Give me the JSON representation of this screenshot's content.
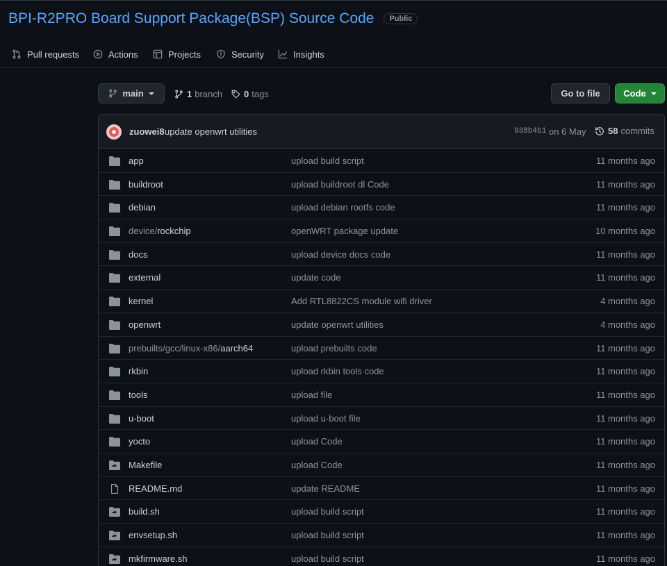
{
  "repo": {
    "title": "BPI-R2PRO Board Support Package(BSP) Source Code",
    "visibility": "Public"
  },
  "nav": [
    {
      "label": "Pull requests",
      "icon": "pull-request-icon"
    },
    {
      "label": "Actions",
      "icon": "play-icon"
    },
    {
      "label": "Projects",
      "icon": "project-board-icon"
    },
    {
      "label": "Security",
      "icon": "shield-icon"
    },
    {
      "label": "Insights",
      "icon": "graph-icon"
    }
  ],
  "toolbar": {
    "branch": "main",
    "branch_count": "1",
    "branch_label": "branch",
    "tag_count": "0",
    "tag_label": "tags",
    "goto_label": "Go to file",
    "code_label": "Code"
  },
  "commit": {
    "author": "zuowei8",
    "message": "update openwrt utilities",
    "hash": "938b4b1",
    "date": "on 6 May",
    "count": "58",
    "count_label": "commits"
  },
  "colors": {
    "link": "#58a6ff",
    "primary_button": "#238636",
    "background": "#0d1117",
    "muted": "#8b949e"
  },
  "files": [
    {
      "type": "dir",
      "prefix": "",
      "name": "app",
      "message": "upload build script",
      "age": "11 months ago"
    },
    {
      "type": "dir",
      "prefix": "",
      "name": "buildroot",
      "message": "upload buildroot dl Code",
      "age": "11 months ago"
    },
    {
      "type": "dir",
      "prefix": "",
      "name": "debian",
      "message": "upload debian rootfs code",
      "age": "11 months ago"
    },
    {
      "type": "dir",
      "prefix": "device/",
      "name": "rockchip",
      "message": "openWRT package update",
      "age": "10 months ago"
    },
    {
      "type": "dir",
      "prefix": "",
      "name": "docs",
      "message": "upload device docs code",
      "age": "11 months ago"
    },
    {
      "type": "dir",
      "prefix": "",
      "name": "external",
      "message": "update code",
      "age": "11 months ago"
    },
    {
      "type": "dir",
      "prefix": "",
      "name": "kernel",
      "message": "Add RTL8822CS module wifi driver",
      "age": "4 months ago"
    },
    {
      "type": "dir",
      "prefix": "",
      "name": "openwrt",
      "message": "update openwrt utilities",
      "age": "4 months ago"
    },
    {
      "type": "dir",
      "prefix": "prebuilts/gcc/linux-x86/",
      "name": "aarch64",
      "message": "upload prebuilts code",
      "age": "11 months ago"
    },
    {
      "type": "dir",
      "prefix": "",
      "name": "rkbin",
      "message": "upload rkbin tools code",
      "age": "11 months ago"
    },
    {
      "type": "dir",
      "prefix": "",
      "name": "tools",
      "message": "upload file",
      "age": "11 months ago"
    },
    {
      "type": "dir",
      "prefix": "",
      "name": "u-boot",
      "message": "upload u-boot file",
      "age": "11 months ago"
    },
    {
      "type": "dir",
      "prefix": "",
      "name": "yocto",
      "message": "upload Code",
      "age": "11 months ago"
    },
    {
      "type": "symlink",
      "prefix": "",
      "name": "Makefile",
      "message": "upload Code",
      "age": "11 months ago"
    },
    {
      "type": "file",
      "prefix": "",
      "name": "README.md",
      "message": "update README",
      "age": "11 months ago"
    },
    {
      "type": "symlink",
      "prefix": "",
      "name": "build.sh",
      "message": "upload build script",
      "age": "11 months ago"
    },
    {
      "type": "symlink",
      "prefix": "",
      "name": "envsetup.sh",
      "message": "upload build script",
      "age": "11 months ago"
    },
    {
      "type": "symlink",
      "prefix": "",
      "name": "mkfirmware.sh",
      "message": "upload build script",
      "age": "11 months ago"
    }
  ]
}
